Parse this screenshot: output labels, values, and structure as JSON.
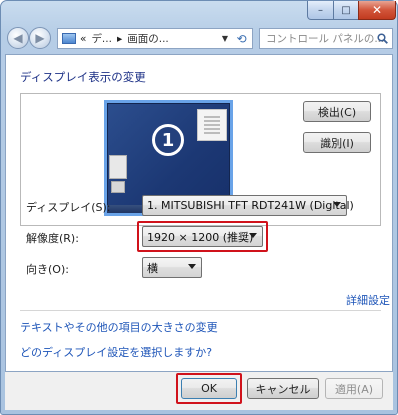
{
  "window": {
    "minimize_glyph": "–",
    "maximize_glyph": "□",
    "close_glyph": "✕"
  },
  "nav": {
    "back_glyph": "◀",
    "forward_glyph": "▶",
    "breadcrumb": [
      "«",
      "デ...",
      "▸",
      "画面の..."
    ],
    "dropdown_glyph": "▼",
    "refresh_glyph": "⟲",
    "search_placeholder": "コントロール パネルの..."
  },
  "heading": "ディスプレイ表示の変更",
  "preview": {
    "monitor_number": "1"
  },
  "buttons": {
    "detect": "検出(C)",
    "identify": "識別(I)",
    "ok": "OK",
    "cancel": "キャンセル",
    "apply": "適用(A)"
  },
  "settings": {
    "display_label": "ディスプレイ(S):",
    "display_value": "1. MITSUBISHI TFT RDT241W (Digital)",
    "resolution_label": "解像度(R):",
    "resolution_value": "1920 × 1200 (推奨)",
    "orientation_label": "向き(O):",
    "orientation_value": "横"
  },
  "links": {
    "advanced": "詳細設定",
    "text_size": "テキストやその他の項目の大きさの変更",
    "which_setting": "どのディスプレイ設定を選択しますか?"
  },
  "colors": {
    "highlight": "#d0121b",
    "link": "#1e55b8",
    "heading": "#1e3287"
  }
}
